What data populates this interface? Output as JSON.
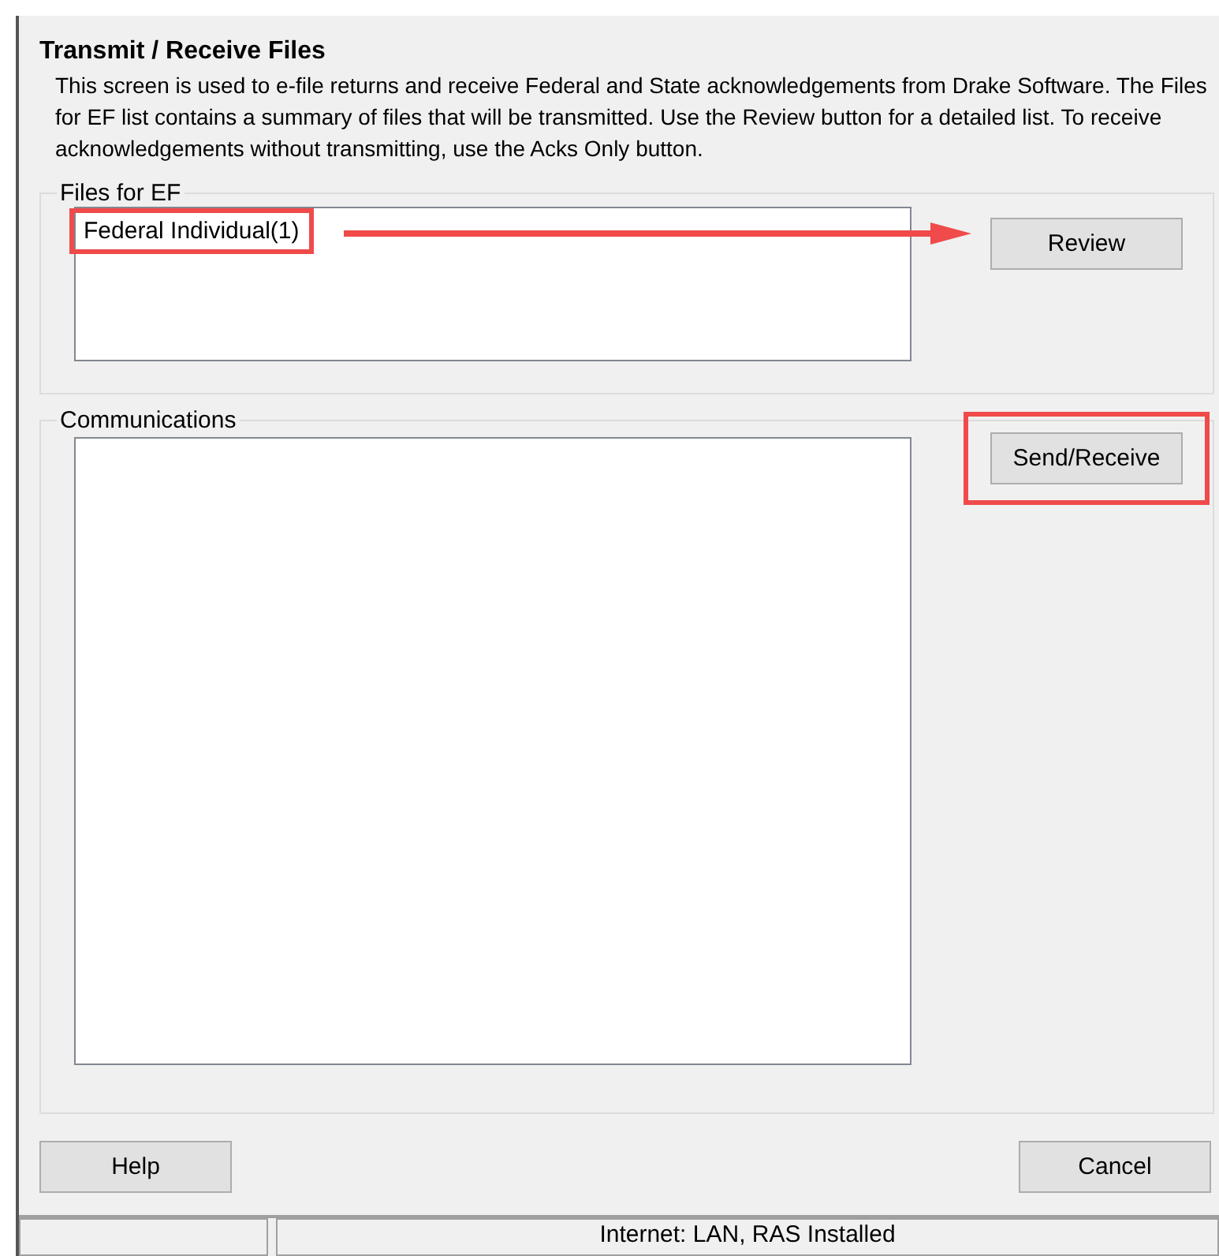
{
  "title": "Transmit / Receive Files",
  "description": "This screen is used to e-file returns and receive Federal and State acknowledgements from Drake Software.  The Files for EF list contains a summary of files that will be transmitted.  Use the Review button for a detailed list.  To receive acknowledgements without transmitting, use the Acks Only button.",
  "files_for_ef": {
    "label": "Files for EF",
    "items": [
      {
        "label": "Federal Individual(1)",
        "highlighted": true
      }
    ],
    "button": {
      "label": "Review",
      "highlighted": false
    },
    "callout_arrow": true
  },
  "communications": {
    "label": "Communications",
    "button": {
      "label": "Send/Receive",
      "highlighted": true
    }
  },
  "buttons": [
    {
      "label": "Help"
    },
    {
      "label": "Cancel"
    }
  ],
  "status_bar": {
    "text": "Internet: LAN, RAS Installed"
  }
}
